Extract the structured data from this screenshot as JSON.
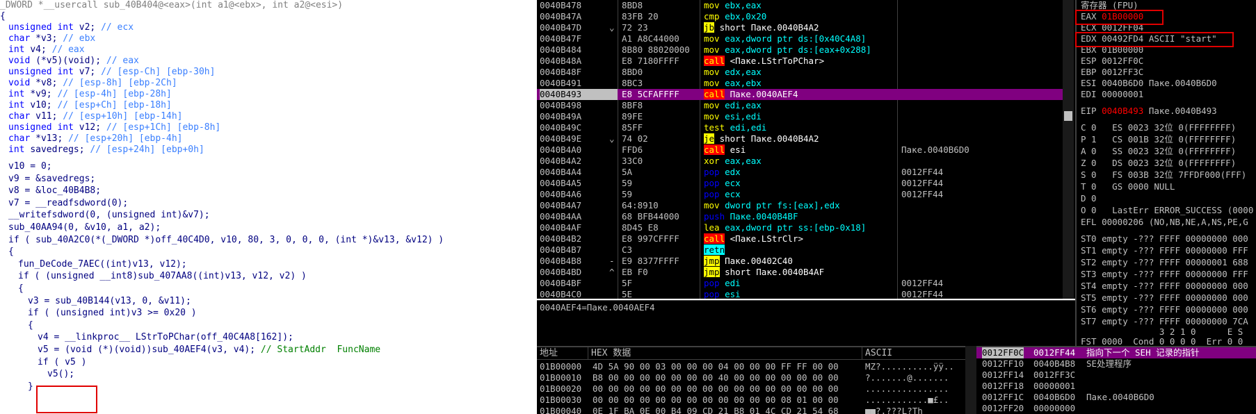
{
  "pseudocode": {
    "header": "_DWORD *__usercall sub_40B404@<eax>(int a1@<ebx>, int a2@<esi>)",
    "open_brace": "{",
    "decls": [
      {
        "type": "unsigned int",
        "name": "v2;",
        "comment": "// ecx"
      },
      {
        "type": "char",
        "name": "*v3;",
        "comment": "// ebx"
      },
      {
        "type": "int",
        "name": "v4;",
        "comment": "// eax"
      },
      {
        "type": "void",
        "name": "(*v5)(void);",
        "comment": "// eax"
      },
      {
        "type": "unsigned int",
        "name": "v7;",
        "comment": "// [esp-Ch] [ebp-30h]"
      },
      {
        "type": "void",
        "name": "*v8;",
        "comment": "// [esp-8h] [ebp-2Ch]"
      },
      {
        "type": "int",
        "name": "*v9;",
        "comment": "// [esp-4h] [ebp-28h]"
      },
      {
        "type": "int",
        "name": "v10;",
        "comment": "// [esp+Ch] [ebp-18h]"
      },
      {
        "type": "char",
        "name": "v11;",
        "comment": "// [esp+10h] [ebp-14h]"
      },
      {
        "type": "unsigned int",
        "name": "v12;",
        "comment": "// [esp+1Ch] [ebp-8h]"
      },
      {
        "type": "char",
        "name": "*v13;",
        "comment": "// [esp+20h] [ebp-4h]"
      },
      {
        "type": "int",
        "name": "savedregs;",
        "comment": "// [esp+24h] [ebp+0h]"
      }
    ],
    "body": [
      "v10 = 0;",
      "v9 = &savedregs;",
      "v8 = &loc_40B4B8;",
      "v7 = __readfsdword(0);",
      "__writefsdword(0, (unsigned int)&v7);",
      "sub_40AA94(0, &v10, a1, a2);",
      "if ( sub_40A2C0(*(_DWORD *)off_40C4D0, v10, 80, 3, 0, 0, 0, (int *)&v13, &v12) )",
      "{",
      "fun_DeCode_7AEC((int)v13, v12);",
      "if ( (unsigned __int8)sub_407AA8((int)v13, v12, v2) )",
      "{",
      "v3 = sub_40B144(v13, 0, &v11);",
      "if ( (unsigned int)v3 >= 0x20 )",
      "{",
      "v4 = __linkproc__ LStrToPChar(off_40C4A8[162]);",
      "v5 = (void (*)(void))sub_40AEF4(v3, v4);",
      "if ( v5 )",
      "v5();",
      "}"
    ],
    "inline_comment": "// StartAddr  FuncName"
  },
  "disasm": {
    "rows": [
      {
        "addr": "0040B478",
        "mark": "",
        "hex": "8BD8",
        "mn": "mov",
        "op": "ebx,eax",
        "kind": "mov",
        "cmt": ""
      },
      {
        "addr": "0040B47A",
        "mark": "",
        "hex": "83FB 20",
        "mn": "cmp",
        "op": "ebx,0x20",
        "kind": "mov",
        "cmt": ""
      },
      {
        "addr": "0040B47D",
        "mark": "⌄",
        "hex": "72 23",
        "mn": "jb",
        "op": "short Пакe.0040B4A2",
        "kind": "jmp",
        "cmt": ""
      },
      {
        "addr": "0040B47F",
        "mark": "",
        "hex": "A1 A8C44000",
        "mn": "mov",
        "op": "eax,dword ptr ds:[0x40C4A8]",
        "kind": "mov",
        "cmt": ""
      },
      {
        "addr": "0040B484",
        "mark": "",
        "hex": "8B80 88020000",
        "mn": "mov",
        "op": "eax,dword ptr ds:[eax+0x288]",
        "kind": "mov",
        "cmt": ""
      },
      {
        "addr": "0040B48A",
        "mark": "",
        "hex": "E8 7180FFFF",
        "mn": "call",
        "op": "<Пакe.LStrToPChar>",
        "kind": "call",
        "cmt": ""
      },
      {
        "addr": "0040B48F",
        "mark": "",
        "hex": "8BD0",
        "mn": "mov",
        "op": "edx,eax",
        "kind": "mov",
        "cmt": ""
      },
      {
        "addr": "0040B491",
        "mark": "",
        "hex": "8BC3",
        "mn": "mov",
        "op": "eax,ebx",
        "kind": "mov",
        "cmt": ""
      },
      {
        "addr": "0040B493",
        "mark": "",
        "hex": "E8 5CFAFFFF",
        "mn": "call",
        "op": "Пакe.0040AEF4",
        "kind": "call",
        "cmt": "",
        "sel": true
      },
      {
        "addr": "0040B498",
        "mark": "",
        "hex": "8BF8",
        "mn": "mov",
        "op": "edi,eax",
        "kind": "mov",
        "cmt": ""
      },
      {
        "addr": "0040B49A",
        "mark": "",
        "hex": "89FE",
        "mn": "mov",
        "op": "esi,edi",
        "kind": "mov",
        "cmt": ""
      },
      {
        "addr": "0040B49C",
        "mark": "",
        "hex": "85FF",
        "mn": "test",
        "op": "edi,edi",
        "kind": "mov",
        "cmt": ""
      },
      {
        "addr": "0040B49E",
        "mark": "⌄",
        "hex": "74 02",
        "mn": "je",
        "op": "short Пакe.0040B4A2",
        "kind": "jmp",
        "cmt": ""
      },
      {
        "addr": "0040B4A0",
        "mark": "",
        "hex": "FFD6",
        "mn": "call",
        "op": "esi",
        "kind": "call",
        "cmt": "Пакe.0040B6D0"
      },
      {
        "addr": "0040B4A2",
        "mark": "",
        "hex": "33C0",
        "mn": "xor",
        "op": "eax,eax",
        "kind": "mov",
        "cmt": ""
      },
      {
        "addr": "0040B4A4",
        "mark": "",
        "hex": "5A",
        "mn": "pop",
        "op": "edx",
        "kind": "push",
        "cmt": "0012FF44"
      },
      {
        "addr": "0040B4A5",
        "mark": "",
        "hex": "59",
        "mn": "pop",
        "op": "ecx",
        "kind": "push",
        "cmt": "0012FF44"
      },
      {
        "addr": "0040B4A6",
        "mark": "",
        "hex": "59",
        "mn": "pop",
        "op": "ecx",
        "kind": "push",
        "cmt": "0012FF44"
      },
      {
        "addr": "0040B4A7",
        "mark": "",
        "hex": "64:8910",
        "mn": "mov",
        "op": "dword ptr fs:[eax],edx",
        "kind": "mov",
        "cmt": ""
      },
      {
        "addr": "0040B4AA",
        "mark": "",
        "hex": "68 BFB44000",
        "mn": "push",
        "op": "Пакe.0040B4BF",
        "kind": "push",
        "cmt": ""
      },
      {
        "addr": "0040B4AF",
        "mark": "",
        "hex": "8D45 E8",
        "mn": "lea",
        "op": "eax,dword ptr ss:[ebp-0x18]",
        "kind": "mov",
        "cmt": ""
      },
      {
        "addr": "0040B4B2",
        "mark": "",
        "hex": "E8 997CFFFF",
        "mn": "call",
        "op": "<Пакe.LStrClr>",
        "kind": "call",
        "cmt": ""
      },
      {
        "addr": "0040B4B7",
        "mark": "",
        "hex": "C3",
        "mn": "retn",
        "op": "",
        "kind": "retn",
        "cmt": ""
      },
      {
        "addr": "0040B4B8",
        "mark": "-",
        "hex": "E9 8377FFFF",
        "mn": "jmp",
        "op": "Пакe.00402C40",
        "kind": "jmp",
        "cmt": ""
      },
      {
        "addr": "0040B4BD",
        "mark": "^",
        "hex": "EB F0",
        "mn": "jmp",
        "op": "short Пакe.0040B4AF",
        "kind": "jmp",
        "cmt": ""
      },
      {
        "addr": "0040B4BF",
        "mark": "",
        "hex": "5F",
        "mn": "pop",
        "op": "edi",
        "kind": "push",
        "cmt": "0012FF44"
      },
      {
        "addr": "0040B4C0",
        "mark": "",
        "hex": "5E",
        "mn": "pop",
        "op": "esi",
        "kind": "push",
        "cmt": "0012FF44"
      }
    ],
    "info": "0040AEF4=Пакe.0040AEF4"
  },
  "registers": {
    "title": "寄存器 (FPU)",
    "eax": {
      "name": "EAX",
      "value": "01B00000"
    },
    "ecx": "ECX 0012FF04",
    "edx": "EDX 00492FD4 ASCII \"start\"",
    "ebx": "EBX 01B00000",
    "esp": "ESP 0012FF0C",
    "ebp": "EBP 0012FF3C",
    "esi": "ESI 0040B6D0 Пакe.0040B6D0",
    "edi": "EDI 00000001",
    "eip": {
      "name": "EIP",
      "value": "0040B493",
      "rest": "Пакe.0040B493"
    },
    "flags": [
      "C 0   ES 0023 32位 0(FFFFFFFF)",
      "P 1   CS 001B 32位 0(FFFFFFFF)",
      "A 0   SS 0023 32位 0(FFFFFFFF)",
      "Z 0   DS 0023 32位 0(FFFFFFFF)",
      "S 0   FS 003B 32位 7FFDF000(FFF)",
      "T 0   GS 0000 NULL",
      "D 0",
      "O 0   LastErr ERROR_SUCCESS (0000"
    ],
    "efl": "EFL 00000206 (NO,NB,NE,A,NS,PE,G",
    "fpu": [
      "ST0 empty -??? FFFF 00000000 000",
      "ST1 empty -??? FFFF 00000000 FFF",
      "ST2 empty -??? FFFF 00000001 688",
      "ST3 empty -??? FFFF 00000000 FFF",
      "ST4 empty -??? FFFF 00000000 000",
      "ST5 empty -??? FFFF 00000000 000",
      "ST6 empty -??? FFFF 00000000 000",
      "ST7 empty -??? FFFF 00000000 7CA"
    ],
    "fst_header": "               3 2 1 0      E S",
    "fst": "FST 0000  Cond 0 0 0 0  Err 0 0"
  },
  "dump": {
    "col_addr": "地址",
    "col_hex": "HEX 数据",
    "col_ascii": "ASCII",
    "rows": [
      {
        "addr": "01B00000",
        "hex": "4D 5A 90 00 03 00 00 00 04 00 00 00 FF FF 00 00",
        "ascii": "MZ?..........ÿÿ.."
      },
      {
        "addr": "01B00010",
        "hex": "B8 00 00 00 00 00 00 00 40 00 00 00 00 00 00 00",
        "ascii": "?.......@......."
      },
      {
        "addr": "01B00020",
        "hex": "00 00 00 00 00 00 00 00 00 00 00 00 00 00 00 00",
        "ascii": "................"
      },
      {
        "addr": "01B00030",
        "hex": "00 00 00 00 00 00 00 00 00 00 00 00 08 01 00 00",
        "ascii": "............■£.."
      },
      {
        "addr": "01B00040",
        "hex": "0E 1F BA 0E 00 B4 09 CD 21 B8 01 4C CD 21 54 68",
        "ascii": "■■?.???L?Th"
      }
    ]
  },
  "stack": {
    "rows": [
      {
        "addr": "0012FF0C",
        "val": "0012FF44",
        "cmt": "指向下一个 SEH 记录的指针",
        "sel": true
      },
      {
        "addr": "0012FF10",
        "val": "0040B4B8",
        "cmt": "SE处理程序"
      },
      {
        "addr": "0012FF14",
        "val": "0012FF3C",
        "cmt": ""
      },
      {
        "addr": "0012FF18",
        "val": "00000001",
        "cmt": ""
      },
      {
        "addr": "0012FF1C",
        "val": "0040B6D0",
        "cmt": "Пакe.0040B6D0"
      },
      {
        "addr": "0012FF20",
        "val": "00000000",
        "cmt": ""
      }
    ]
  },
  "colors": {
    "highlight_box": "#e00000",
    "selected_row": "#800080",
    "call_bg": "#ff0000",
    "jmp_bg": "#ffff00"
  }
}
